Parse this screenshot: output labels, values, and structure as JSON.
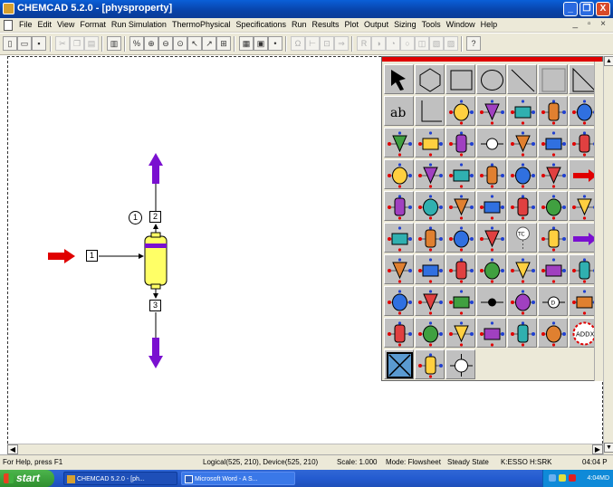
{
  "window": {
    "title": "CHEMCAD 5.2.0 - [physproperty]",
    "min_label": "_",
    "max_label": "❐",
    "close_label": "X"
  },
  "menu": {
    "items": [
      "File",
      "Edit",
      "View",
      "Format",
      "Run Simulation",
      "ThermoPhysical",
      "Specifications",
      "Run",
      "Results",
      "Plot",
      "Output",
      "Sizing",
      "Tools",
      "Window",
      "Help"
    ],
    "mdi_controls": "_ ▫ ×"
  },
  "flowsheet": {
    "streams": [
      {
        "id": "1"
      },
      {
        "id": "2"
      },
      {
        "id": "3"
      }
    ],
    "unit": {
      "id": "1"
    }
  },
  "palette": {
    "rows": [
      [
        "select-arrow",
        "rotate-polygon",
        "rectangle",
        "ellipse",
        "line",
        "square-shape",
        "triangle-shape"
      ],
      [
        "text-ab",
        "polyline",
        "flash",
        "compressor-unit",
        "heat-exchanger",
        "data-sheet",
        "filter-unit"
      ],
      [
        "mixer",
        "expander",
        "valve",
        "controller",
        "divider",
        "pump-unit",
        "cyclone"
      ],
      [
        "vessel",
        "tank-heater",
        "column",
        "reactor",
        "fired-heater",
        "tower",
        "stream-arrow"
      ],
      [
        "drum",
        "stripper",
        "reactor-green",
        "rotary",
        "hopper",
        "agitated-tank",
        "column-blue"
      ],
      [
        "heat-exchanger-long",
        "pump-circle",
        "vessel-small",
        "valve-dotted",
        "controller-tc",
        "pipe",
        "purple-arrow"
      ],
      [
        "compressor-yellow",
        "reactor-red",
        "crystallizer",
        "tower-tall",
        "cone",
        "exchanger-green",
        "distillation"
      ],
      [
        "scrubber",
        "reactor-brown",
        "reactor-blue",
        "node",
        "settler",
        "dryer-d",
        "membrane"
      ],
      [
        "column-multi",
        "column-multi2",
        "filter-plate",
        "check-valve",
        "reactor-purple",
        "mixer-yellow",
        "addx"
      ],
      [
        "selected-x",
        "tower-frame",
        "node-cross"
      ]
    ],
    "addx_label": "ADDX",
    "text_label": "ab",
    "tc_label": "TC",
    "d_label": "D"
  },
  "status": {
    "help": "For Help, press F1",
    "coords": "Logical(525, 210), Device(525, 210)",
    "scale": "Scale: 1.000",
    "mode": "Mode: Flowsheet",
    "state": "Steady State",
    "thermo": "K:ESSO H:SRK",
    "time": "04:04 P"
  },
  "taskbar": {
    "start": "start",
    "items": [
      "CHEMCAD 5.2.0 - [ph...",
      "Microsoft Word - A S..."
    ],
    "clock": "4:04MD"
  },
  "colors": {
    "stream_in": "#e00000",
    "stream_out": "#7a10d0",
    "vessel": "#ffff66",
    "palette_red": "#e00000"
  }
}
